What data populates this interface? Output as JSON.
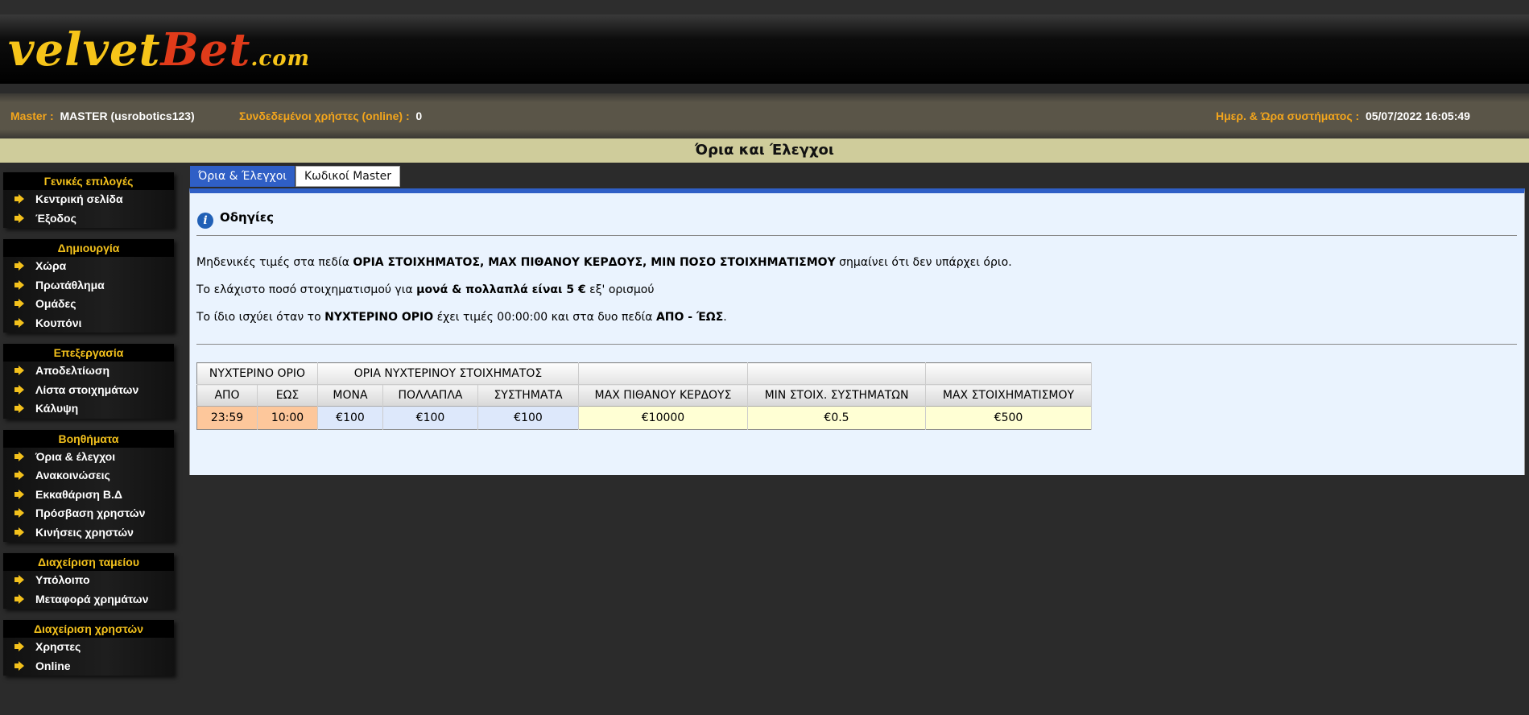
{
  "logo": {
    "part1": "velvet",
    "part2": "Bet",
    "part3": ".com"
  },
  "infobar": {
    "master_label": "Master :",
    "master_value": "MASTER (usrobotics123)",
    "online_label": "Συνδεδεμένοι χρήστες (online) :",
    "online_value": "0",
    "datetime_label": "Ημερ. & Ώρα συστήματος :",
    "datetime_value": "05/07/2022 16:05:49"
  },
  "page_title": "Όρια και Έλεγχοι",
  "sidebar": {
    "groups": [
      {
        "title": "Γενικές επιλογές",
        "items": [
          "Κεντρική σελίδα",
          "Έξοδος"
        ]
      },
      {
        "title": "Δημιουργία",
        "items": [
          "Χώρα",
          "Πρωτάθλημα",
          "Ομάδες",
          "Κουπόνι"
        ]
      },
      {
        "title": "Επεξεργασία",
        "items": [
          "Αποδελτίωση",
          "Λίστα στοιχημάτων",
          "Κάλυψη"
        ]
      },
      {
        "title": "Βοηθήματα",
        "items": [
          "Όρια & έλεγχοι",
          "Ανακοινώσεις",
          "Εκκαθάριση Β.Δ",
          "Πρόσβαση χρηστών",
          "Κινήσεις χρηστών"
        ]
      },
      {
        "title": "Διαχείριση ταμείου",
        "items": [
          "Υπόλοιπο",
          "Μεταφορά χρημάτων"
        ]
      },
      {
        "title": "Διαχείριση χρηστών",
        "items": [
          "Χρηστες",
          "Online"
        ]
      }
    ]
  },
  "tabs": {
    "active": "Όρια & Έλεγχοι",
    "inactive": "Κωδικοί Master"
  },
  "help": {
    "title": "Οδηγίες",
    "p1_a": "Μηδενικές τιμές στα πεδία ",
    "p1_b": "ΟΡΙΑ ΣΤΟΙΧΗΜΑΤΟΣ, ΜΑΧ ΠΙΘΑΝΟΥ ΚΕΡΔΟΥΣ, ΜΙΝ ΠΟΣΟ ΣΤΟΙΧΗΜΑΤΙΣΜΟΥ",
    "p1_c": " σημαίνει ότι δεν υπάρχει όριο.",
    "p2_a": "Το ελάχιστο ποσό στοιχηματισμού για ",
    "p2_b": "μονά & πολλαπλά είναι 5 €",
    "p2_c": " εξ' ορισμού",
    "p3_a": "Το ίδιο ισχύει όταν το ",
    "p3_b": "ΝΥΧΤΕΡΙΝΟ ΟΡΙΟ",
    "p3_c": " έχει τιμές 00:00:00 και στα δυο πεδία ",
    "p3_d": "ΑΠΟ - ΈΩΣ",
    "p3_e": "."
  },
  "table": {
    "h1": {
      "night": "ΝΥΧΤΕΡΙΝΟ ΟΡΙΟ",
      "night_bet": "ΟΡΙΑ ΝΥΧΤΕΡΙΝΟΥ ΣΤΟΙΧΗΜΑΤΟΣ"
    },
    "h2": {
      "apo": "ΑΠΟ",
      "eos": "ΕΩΣ",
      "mona": "ΜΟΝΑ",
      "pollapla": "ΠΟΛΛΑΠΛΑ",
      "systimata": "ΣΥΣΤΗΜΑΤΑ",
      "max_kerdos": "ΜΑΧ ΠΙΘΑΝΟΥ ΚΕΡΔΟΥΣ",
      "min_systimata": "ΜΙΝ ΣΤΟΙΧ. ΣΥΣΤΗΜΑΤΩΝ",
      "max_stoix": "ΜΑΧ ΣΤΟΙΧΗΜΑΤΙΣΜΟΥ"
    },
    "row": {
      "apo": "23:59",
      "eos": "10:00",
      "mona": "€100",
      "pollapla": "€100",
      "systimata": "€100",
      "max_kerdos": "€10000",
      "min_systimata": "€0.5",
      "max_stoix": "€500"
    }
  },
  "colors": {
    "accent": "#2f5fc6",
    "gold": "#f3c11c",
    "orange": "#f3a51c",
    "title_bg": "#cfcc9b"
  }
}
